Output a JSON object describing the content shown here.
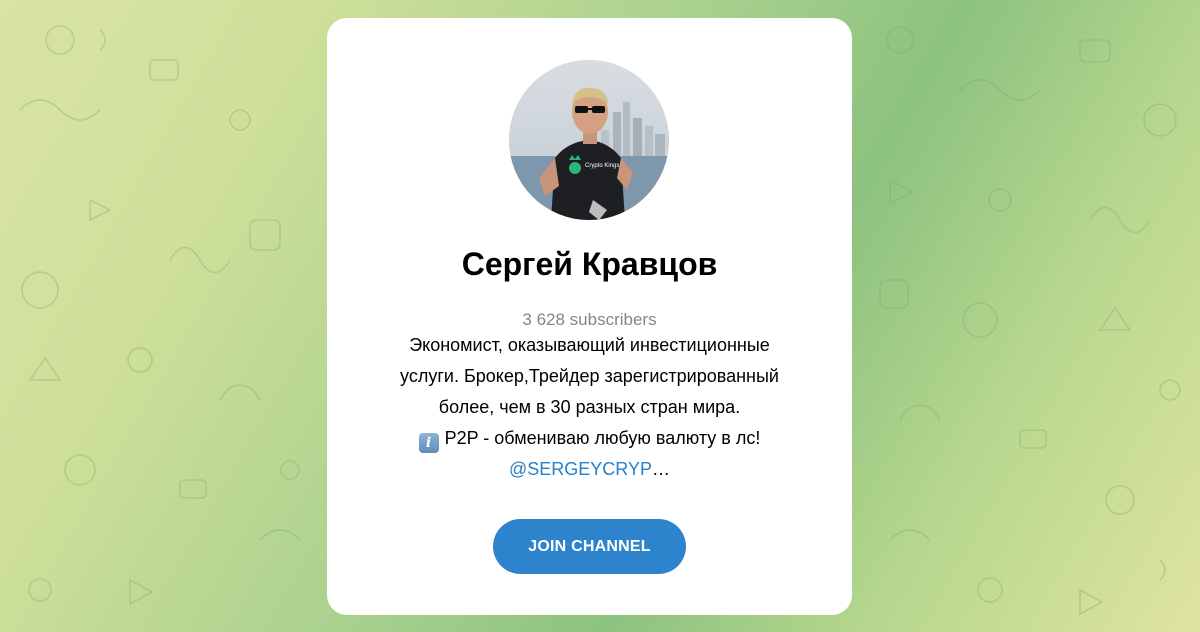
{
  "channel": {
    "name": "Сергей Кравцов",
    "subscribers": "3 628 subscribers",
    "description_lines": [
      "Экономист, оказывающий инвестиционные",
      "услуги. Брокер,Трейдер зарегистрированный",
      "более, чем в 30 разных стран мира."
    ],
    "info_line": "P2P - обмениваю любую валюту в лс!",
    "info_emoji": "i",
    "mention": "@SERGEYCRYP",
    "mention_ellipsis": "…",
    "avatar_shirt_text": "Crypto Kings"
  },
  "actions": {
    "join_label": "JOIN CHANNEL"
  },
  "colors": {
    "accent": "#2d84cc",
    "link": "#2481cc",
    "muted": "#868686",
    "background_green": "#a9d18e"
  },
  "icons": {
    "background": "doodle-pattern",
    "info": "information-emoji"
  }
}
